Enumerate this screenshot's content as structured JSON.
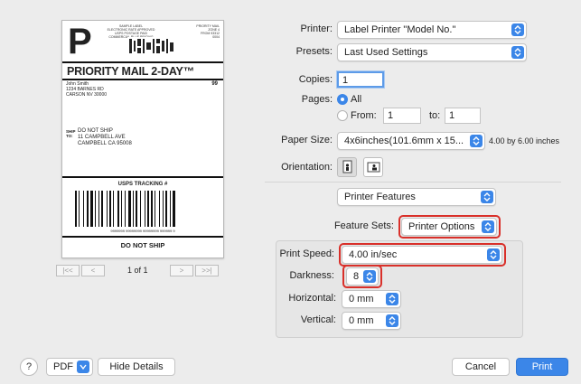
{
  "preview": {
    "big_letter": "P",
    "top_info": [
      "SAMPLE LABEL",
      "ELECTRONIC RATE APPROVED",
      "USPS POSTAGE PAID",
      "COMMERCIAL PLUS PRICING"
    ],
    "top_info2": [
      "PRIORITY MAIL",
      "ZONE 4",
      "FROM 93312",
      "0004"
    ],
    "service": "PRIORITY MAIL 2-DAY™",
    "from_lines": [
      "John Smith",
      "1234 BARNES RD",
      "CARSON NV 30000"
    ],
    "code": "99",
    "ship_to_label": "SHIP\nTO:",
    "to_lines": [
      "DO NOT SHIP",
      "11 CAMPBELL AVE",
      "CAMPBELL CA 95008"
    ],
    "tracking_label": "USPS TRACKING #",
    "tracking_number": "9999999 99999999 99999999 999999 9",
    "footer": "DO NOT SHIP"
  },
  "pager": {
    "first": "|<<",
    "prev": "<",
    "page_text": "1 of 1",
    "next": ">",
    "last": ">>|"
  },
  "form": {
    "printer_label": "Printer:",
    "printer_value": "Label Printer  \"Model No.\"",
    "presets_label": "Presets:",
    "presets_value": "Last Used Settings",
    "copies_label": "Copies:",
    "copies_value": "1",
    "pages_label": "Pages:",
    "pages_all": "All",
    "pages_from_label": "From:",
    "pages_from": "1",
    "pages_to_label": "to:",
    "pages_to": "1",
    "paper_label": "Paper Size:",
    "paper_value": "4x6inches(101.6mm x 15...",
    "paper_dims": "4.00 by 6.00 inches",
    "orientation_label": "Orientation:",
    "section_value": "Printer Features",
    "feature_sets_label": "Feature Sets:",
    "feature_sets_value": "Printer Options",
    "print_speed_label": "Print Speed:",
    "print_speed_value": "4.00 in/sec",
    "darkness_label": "Darkness:",
    "darkness_value": "8",
    "horizontal_label": "Horizontal:",
    "horizontal_value": "0 mm",
    "vertical_label": "Vertical:",
    "vertical_value": "0 mm"
  },
  "bottom": {
    "help": "?",
    "pdf": "PDF",
    "hide_details": "Hide Details",
    "cancel": "Cancel",
    "print": "Print"
  },
  "colors": {
    "accent": "#3b86e8",
    "highlight": "#d9302a",
    "window_bg": "#ececec"
  }
}
